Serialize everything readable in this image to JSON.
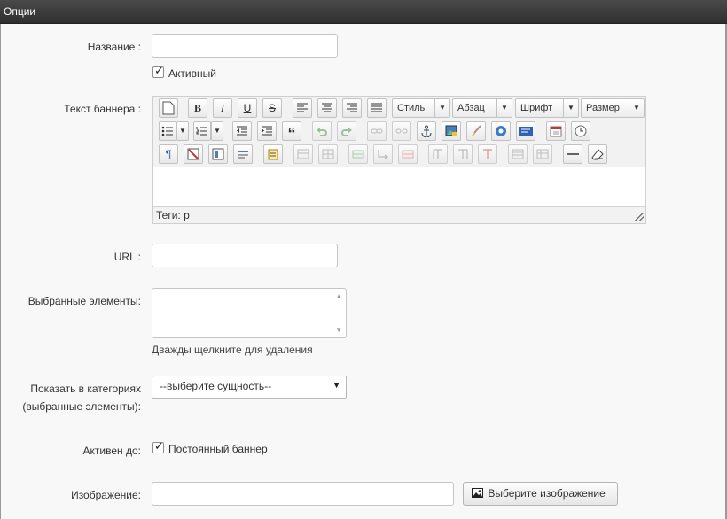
{
  "panel": {
    "title": "Опции"
  },
  "form": {
    "name_label": "Название :",
    "name_value": "",
    "active_label": "Активный",
    "active_checked": true,
    "banner_text_label": "Текст баннера :",
    "url_label": "URL :",
    "url_value": "",
    "selected_label": "Выбранные элементы:",
    "selected_hint": "Дважды щелкните для удаления",
    "show_in_categories_label_1": "Показать в категориях",
    "show_in_categories_label_2": "(выбранные элементы):",
    "category_select_value": "--выберите сущность--",
    "active_until_label": "Активен до:",
    "permanent_label": "Постоянный баннер",
    "permanent_checked": true,
    "image_label": "Изображение:",
    "image_value": "",
    "choose_image_button": "Выберите изображение"
  },
  "editor": {
    "style_dropdown": "Стиль",
    "paragraph_dropdown": "Абзац",
    "font_dropdown": "Шрифт",
    "size_dropdown": "Размер",
    "status_text": "Теги: p",
    "bold_glyph": "B",
    "italic_glyph": "I",
    "underline_glyph": "U",
    "strike_glyph": "S"
  },
  "icons": {
    "checked_glyph": "✓",
    "dropdown_arrow": "▼"
  }
}
